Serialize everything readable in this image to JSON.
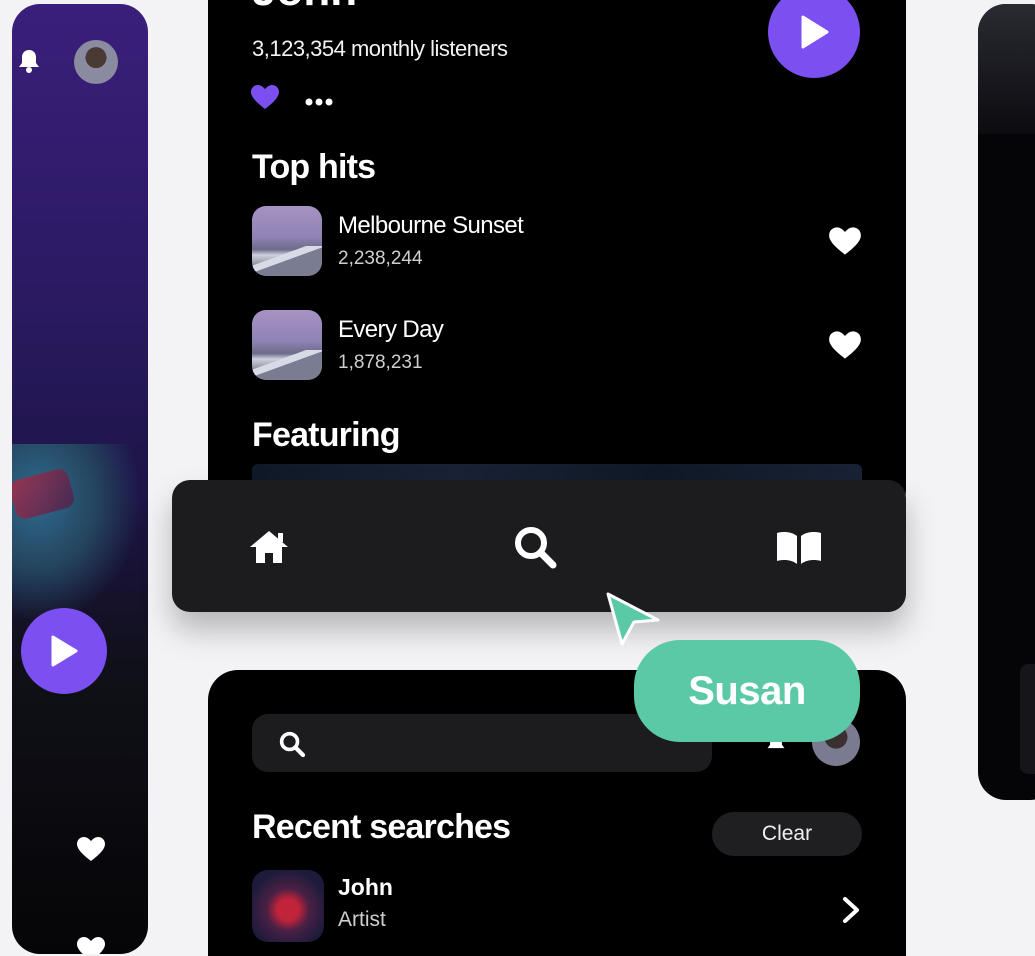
{
  "artist": {
    "name_partial": "John",
    "monthly_listeners": "3,123,354 monthly listeners"
  },
  "sections": {
    "top_hits": "Top hits",
    "featuring": "Featuring"
  },
  "tracks": [
    {
      "title": "Melbourne Sunset",
      "plays": "2,238,244"
    },
    {
      "title": "Every Day",
      "plays": "1,878,231"
    }
  ],
  "nav": {
    "items": [
      {
        "icon": "home-icon"
      },
      {
        "icon": "search-icon"
      },
      {
        "icon": "library-book-icon"
      }
    ]
  },
  "cursor": {
    "label": "Susan",
    "color": "#5cc9a6"
  },
  "search_screen": {
    "recent_title": "Recent searches",
    "clear_label": "Clear",
    "recent": [
      {
        "name": "John",
        "type": "Artist"
      }
    ]
  },
  "colors": {
    "accent": "#7b4ff0",
    "background": "#000000",
    "nav_bg": "#1c1c1e"
  }
}
